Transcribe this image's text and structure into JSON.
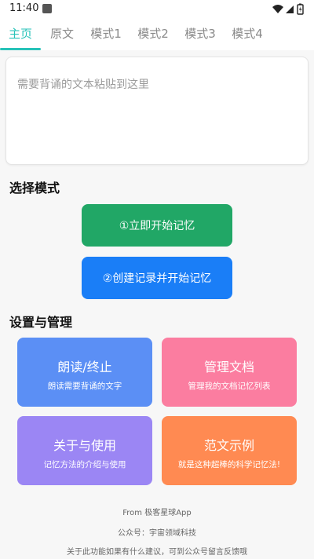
{
  "status_bar": {
    "time": "11:40",
    "icons": [
      "app-notification-icon",
      "wifi-icon",
      "cell-signal-icon",
      "battery-icon"
    ]
  },
  "tabs": [
    {
      "label": "主页",
      "active": true
    },
    {
      "label": "原文",
      "active": false
    },
    {
      "label": "模式1",
      "active": false
    },
    {
      "label": "模式2",
      "active": false
    },
    {
      "label": "模式3",
      "active": false
    },
    {
      "label": "模式4",
      "active": false
    }
  ],
  "text_input": {
    "placeholder": "需要背诵的文本粘贴到这里",
    "value": ""
  },
  "select_mode": {
    "title": "选择模式",
    "buttons": [
      {
        "label": "①立即开始记忆",
        "color": "#21a766"
      },
      {
        "label": "②创建记录并开始记忆",
        "color": "#1a7ef7"
      }
    ]
  },
  "settings": {
    "title": "设置与管理",
    "cards": [
      {
        "title": "朗读/终止",
        "desc": "朗读需要背诵的文字",
        "color": "#5b8ff5"
      },
      {
        "title": "管理文档",
        "desc": "管理我的文档记忆列表",
        "color": "#fb7da0"
      },
      {
        "title": "关于与使用",
        "desc": "记忆方法的介绍与使用",
        "color": "#9b86f4"
      },
      {
        "title": "范文示例",
        "desc": "就是这种超棒的科学记忆法!",
        "color": "#ff8a52"
      }
    ]
  },
  "footer": {
    "line1": "From 极客星球App",
    "line2": "公众号：宇宙领域科技",
    "line3": "关于此功能如果有什么建议，可到公众号留言反馈哦"
  },
  "colors": {
    "accent": "#27c2b8"
  }
}
